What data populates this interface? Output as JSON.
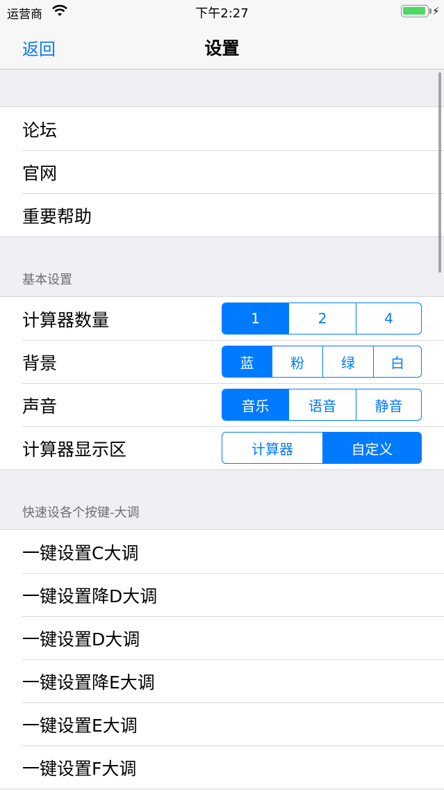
{
  "status_bar": {
    "carrier": "运营商",
    "time": "下午2:27"
  },
  "nav": {
    "back_label": "返回",
    "title": "设置"
  },
  "links": [
    {
      "label": "论坛"
    },
    {
      "label": "官网"
    },
    {
      "label": "重要帮助"
    }
  ],
  "basic": {
    "header": "基本设置",
    "calculator_count": {
      "label": "计算器数量",
      "options": [
        "1",
        "2",
        "4"
      ],
      "selected": 0
    },
    "background": {
      "label": "背景",
      "options": [
        "蓝",
        "粉",
        "绿",
        "白"
      ],
      "selected": 0
    },
    "sound": {
      "label": "声音",
      "options": [
        "音乐",
        "语音",
        "静音"
      ],
      "selected": 0
    },
    "display_area": {
      "label": "计算器显示区",
      "options": [
        "计算器",
        "自定义"
      ],
      "selected": 1
    }
  },
  "quick_keys": {
    "header": "快速设各个按键-大调",
    "items": [
      {
        "label": "一键设置C大调"
      },
      {
        "label": "一键设置降D大调"
      },
      {
        "label": "一键设置D大调"
      },
      {
        "label": "一键设置降E大调"
      },
      {
        "label": "一键设置E大调"
      },
      {
        "label": "一键设置F大调"
      }
    ]
  },
  "colors": {
    "accent": "#007aff",
    "battery": "#4cd964",
    "background": "#efeff4"
  }
}
